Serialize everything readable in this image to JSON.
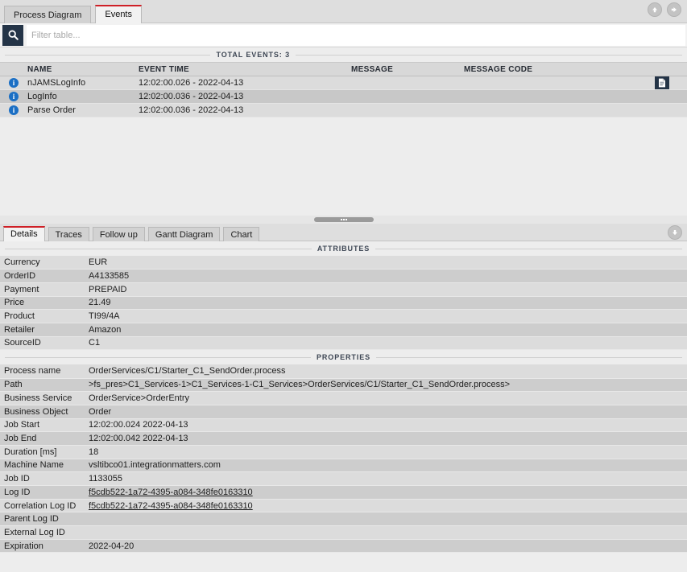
{
  "top_tabs": {
    "items": [
      {
        "label": "Process Diagram",
        "active": false
      },
      {
        "label": "Events",
        "active": true
      }
    ],
    "nav": {
      "up_icon": "arrow-up-circle-icon",
      "forward_icon": "arrow-right-circle-icon"
    }
  },
  "filter": {
    "search_icon": "search-icon",
    "placeholder": "Filter table...",
    "value": ""
  },
  "events_section": {
    "caption": "TOTAL EVENTS: 3",
    "columns": [
      "",
      "NAME",
      "EVENT TIME",
      "MESSAGE",
      "MESSAGE CODE",
      ""
    ],
    "rows": [
      {
        "icon": "info-icon",
        "icon_glyph": "i",
        "name": "nJAMSLogInfo",
        "event_time": "12:02:00.026 - 2022-04-13",
        "message": "",
        "message_code": "",
        "action_icon": "document-icon",
        "has_action": true,
        "selected": false
      },
      {
        "icon": "info-icon",
        "icon_glyph": "i",
        "name": "LogInfo",
        "event_time": "12:02:00.036 - 2022-04-13",
        "message": "",
        "message_code": "",
        "action_icon": "",
        "has_action": false,
        "selected": true
      },
      {
        "icon": "info-icon",
        "icon_glyph": "i",
        "name": "Parse Order",
        "event_time": "12:02:00.036 - 2022-04-13",
        "message": "",
        "message_code": "",
        "action_icon": "",
        "has_action": false,
        "selected": false
      }
    ]
  },
  "splitter": {
    "handle_icon": "drag-handle-icon"
  },
  "bottom_tabs": {
    "items": [
      {
        "label": "Details",
        "active": true
      },
      {
        "label": "Traces",
        "active": false
      },
      {
        "label": "Follow up",
        "active": false
      },
      {
        "label": "Gantt Diagram",
        "active": false
      },
      {
        "label": "Chart",
        "active": false
      }
    ],
    "nav": {
      "down_icon": "arrow-down-circle-icon"
    }
  },
  "attributes_section": {
    "caption": "ATTRIBUTES",
    "rows": [
      {
        "key": "Currency",
        "value": "EUR",
        "link": false
      },
      {
        "key": "OrderID",
        "value": "A4133585",
        "link": false
      },
      {
        "key": "Payment",
        "value": "PREPAID",
        "link": false
      },
      {
        "key": "Price",
        "value": "21.49",
        "link": false
      },
      {
        "key": "Product",
        "value": "TI99/4A",
        "link": false
      },
      {
        "key": "Retailer",
        "value": "Amazon",
        "link": false
      },
      {
        "key": "SourceID",
        "value": "C1",
        "link": false
      }
    ]
  },
  "properties_section": {
    "caption": "PROPERTIES",
    "rows": [
      {
        "key": "Process name",
        "value": "OrderServices/C1/Starter_C1_SendOrder.process",
        "link": false
      },
      {
        "key": "Path",
        "value": ">fs_pres>C1_Services-1>C1_Services-1-C1_Services>OrderServices/C1/Starter_C1_SendOrder.process>",
        "link": false
      },
      {
        "key": "Business Service",
        "value": "OrderService>OrderEntry",
        "link": false
      },
      {
        "key": "Business Object",
        "value": "Order",
        "link": false
      },
      {
        "key": "Job Start",
        "value": "12:02:00.024   2022-04-13",
        "link": false
      },
      {
        "key": "Job End",
        "value": "12:02:00.042   2022-04-13",
        "link": false
      },
      {
        "key": "Duration [ms]",
        "value": "18",
        "link": false
      },
      {
        "key": "Machine Name",
        "value": "vsltibco01.integrationmatters.com",
        "link": false
      },
      {
        "key": "Job ID",
        "value": "1133055",
        "link": false
      },
      {
        "key": "Log ID",
        "value": "f5cdb522-1a72-4395-a084-348fe0163310",
        "link": true
      },
      {
        "key": "Correlation Log ID",
        "value": "f5cdb522-1a72-4395-a084-348fe0163310",
        "link": true
      },
      {
        "key": "Parent Log ID",
        "value": "",
        "link": false
      },
      {
        "key": "External Log ID",
        "value": "",
        "link": false
      },
      {
        "key": "Expiration",
        "value": "2022-04-20",
        "link": false
      }
    ]
  },
  "colors": {
    "accent_red": "#cf2027",
    "dark_navy": "#243447",
    "info_blue": "#1b6fc4",
    "panel_bg": "#ededed",
    "row_light": "#dcdcdc",
    "row_dark": "#cdcdcd"
  }
}
